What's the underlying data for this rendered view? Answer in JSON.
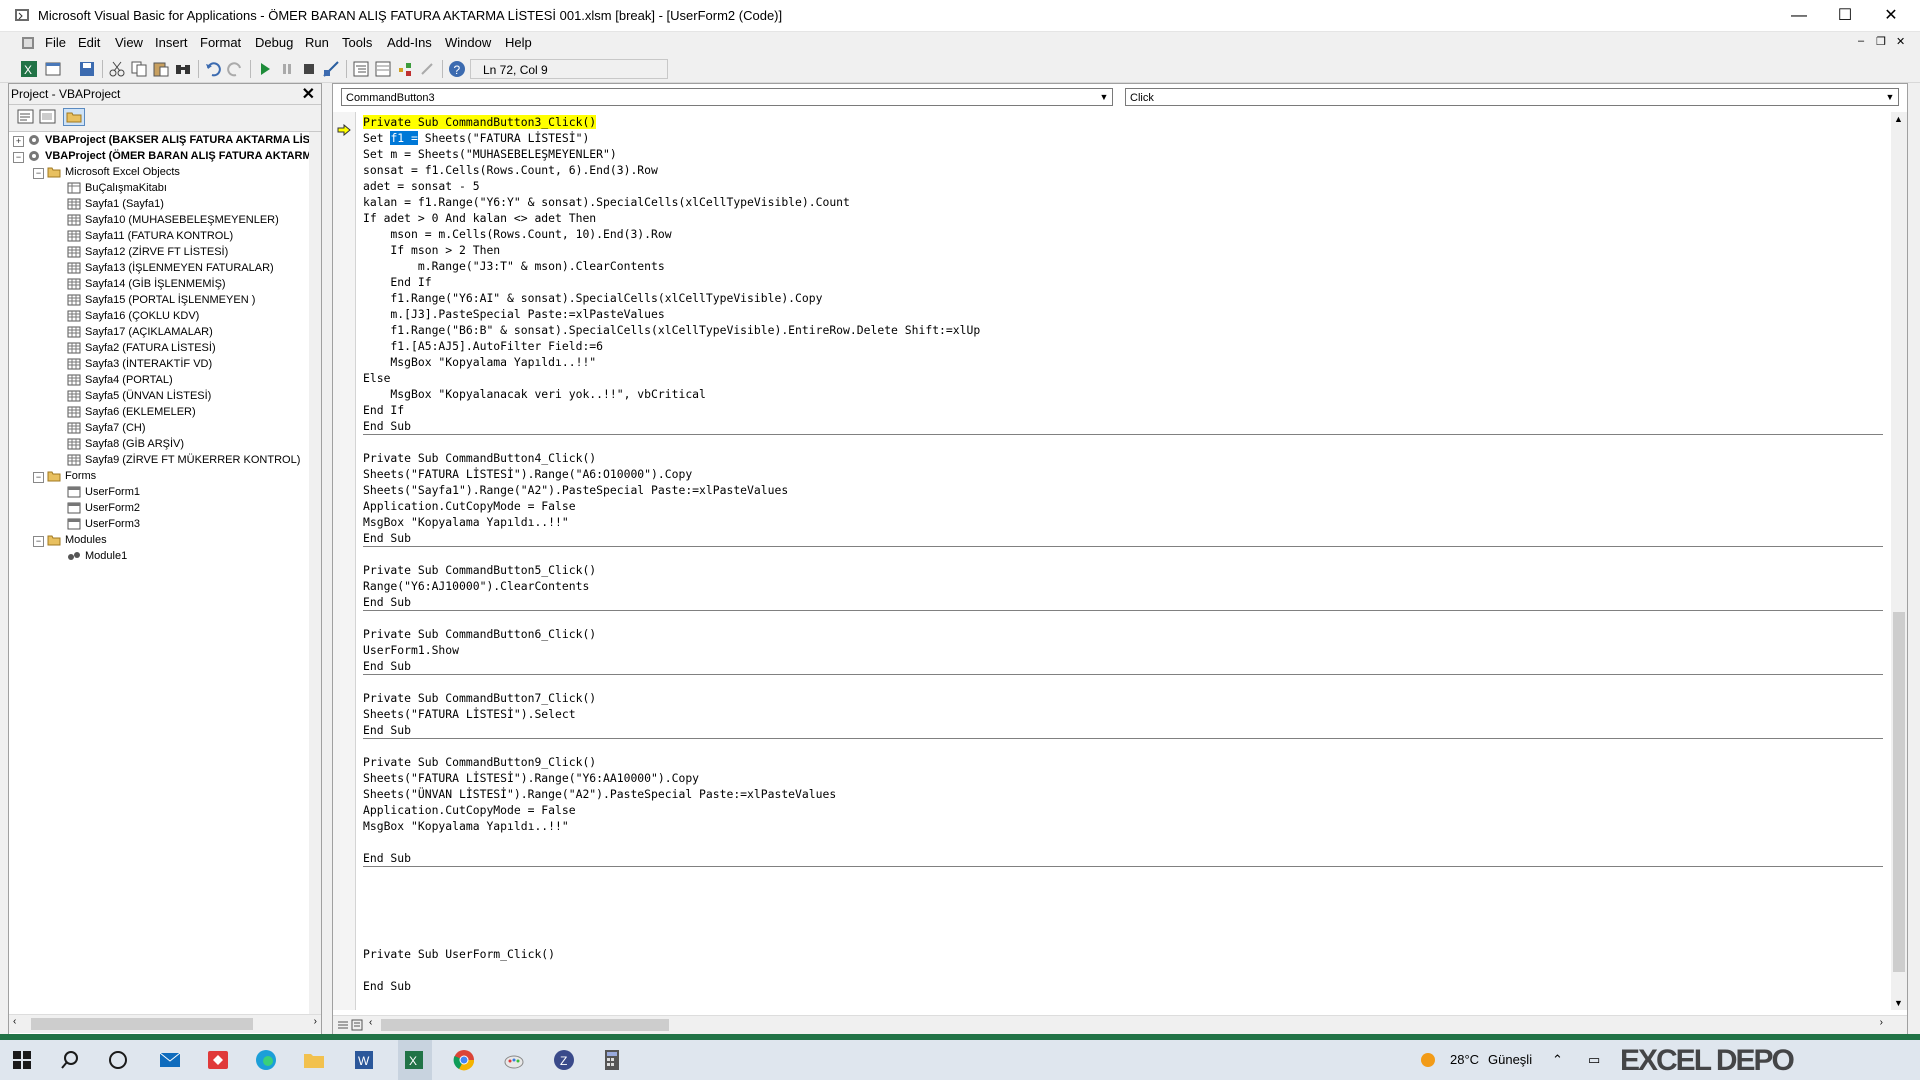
{
  "window": {
    "title": "Microsoft Visual Basic for Applications - ÖMER BARAN ALIŞ FATURA AKTARMA LİSTESİ 001.xlsm [break] - [UserForm2 (Code)]",
    "minimize": "—",
    "maximize": "☐",
    "close": "✕"
  },
  "menu": {
    "items": [
      "File",
      "Edit",
      "View",
      "Insert",
      "Format",
      "Debug",
      "Run",
      "Tools",
      "Add-Ins",
      "Window",
      "Help"
    ],
    "mdi_min": "‒",
    "mdi_restore": "❐",
    "mdi_close": "✕"
  },
  "toolbar": {
    "position": "Ln 72, Col 9"
  },
  "project": {
    "title": "Project - VBAProject",
    "close": "✕",
    "tree": [
      "VBAProject (BAKSER ALIŞ FATURA AKTARMA LİS",
      "VBAProject (ÖMER BARAN ALIŞ FATURA AKTARM",
      "Microsoft Excel Objects",
      "BuÇalışmaKitabı",
      "Sayfa1 (Sayfa1)",
      "Sayfa10 (MUHASEBELEŞMEYENLER)",
      "Sayfa11 (FATURA KONTROL)",
      "Sayfa12 (ZİRVE FT LİSTESİ)",
      "Sayfa13 (İŞLENMEYEN FATURALAR)",
      "Sayfa14 (GİB İŞLENMEMİŞ)",
      "Sayfa15 (PORTAL İŞLENMEYEN )",
      "Sayfa16 (ÇOKLU KDV)",
      "Sayfa17 (AÇIKLAMALAR)",
      "Sayfa2 (FATURA LİSTESİ)",
      "Sayfa3 (İNTERAKTİF VD)",
      "Sayfa4 (PORTAL)",
      "Sayfa5 (ÜNVAN LİSTESİ)",
      "Sayfa6 (EKLEMELER)",
      "Sayfa7 (CH)",
      "Sayfa8 (GİB ARŞİV)",
      "Sayfa9 (ZİRVE FT MÜKERRER KONTROL)",
      "Forms",
      "UserForm1",
      "UserForm2",
      "UserForm3",
      "Modules",
      "Module1"
    ]
  },
  "code": {
    "object_combo": "CommandButton3",
    "proc_combo": "Click",
    "lines": [
      "Private Sub CommandButton3_Click()",
      "Set ",
      "f1 =",
      " Sheets(\"FATURA LİSTESİ\")",
      "Set m = Sheets(\"MUHASEBELEŞMEYENLER\")",
      "sonsat = f1.Cells(Rows.Count, 6).End(3).Row",
      "adet = sonsat - 5",
      "kalan = f1.Range(\"Y6:Y\" & sonsat).SpecialCells(xlCellTypeVisible).Count",
      "If adet > 0 And kalan <> adet Then",
      "    mson = m.Cells(Rows.Count, 10).End(3).Row",
      "    If mson > 2 Then",
      "        m.Range(\"J3:T\" & mson).ClearContents",
      "    End If",
      "    f1.Range(\"Y6:AI\" & sonsat).SpecialCells(xlCellTypeVisible).Copy",
      "    m.[J3].PasteSpecial Paste:=xlPasteValues",
      "    f1.Range(\"B6:B\" & sonsat).SpecialCells(xlCellTypeVisible).EntireRow.Delete Shift:=xlUp",
      "    f1.[A5:AJ5].AutoFilter Field:=6",
      "    MsgBox \"Kopyalama Yapıldı..!!\"",
      "Else",
      "    MsgBox \"Kopyalanacak veri yok..!!\", vbCritical",
      "End If",
      "End Sub",
      "Private Sub CommandButton4_Click()",
      "Sheets(\"FATURA LİSTESİ\").Range(\"A6:O10000\").Copy",
      "Sheets(\"Sayfa1\").Range(\"A2\").PasteSpecial Paste:=xlPasteValues",
      "Application.CutCopyMode = False",
      "MsgBox \"Kopyalama Yapıldı..!!\"",
      "End Sub",
      "Private Sub CommandButton5_Click()",
      "Range(\"Y6:AJ10000\").ClearContents",
      "End Sub",
      "Private Sub CommandButton6_Click()",
      "UserForm1.Show",
      "End Sub",
      "Private Sub CommandButton7_Click()",
      "Sheets(\"FATURA LİSTESİ\").Select",
      "End Sub",
      "Private Sub CommandButton9_Click()",
      "Sheets(\"FATURA LİSTESİ\").Range(\"Y6:AA10000\").Copy",
      "Sheets(\"ÜNVAN LİSTESİ\").Range(\"A2\").PasteSpecial Paste:=xlPasteValues",
      "Application.CutCopyMode = False",
      "MsgBox \"Kopyalama Yapıldı..!!\"",
      "End Sub",
      "Private Sub UserForm_Click()",
      "End Sub"
    ]
  },
  "taskbar": {
    "temperature": "28°C",
    "weather": "Güneşli",
    "watermark": "EXCEL DEPO"
  },
  "colors": {
    "highlight": "#ffff00",
    "selection": "#0078d7",
    "keyword": "#000000",
    "accent": "#217346"
  }
}
